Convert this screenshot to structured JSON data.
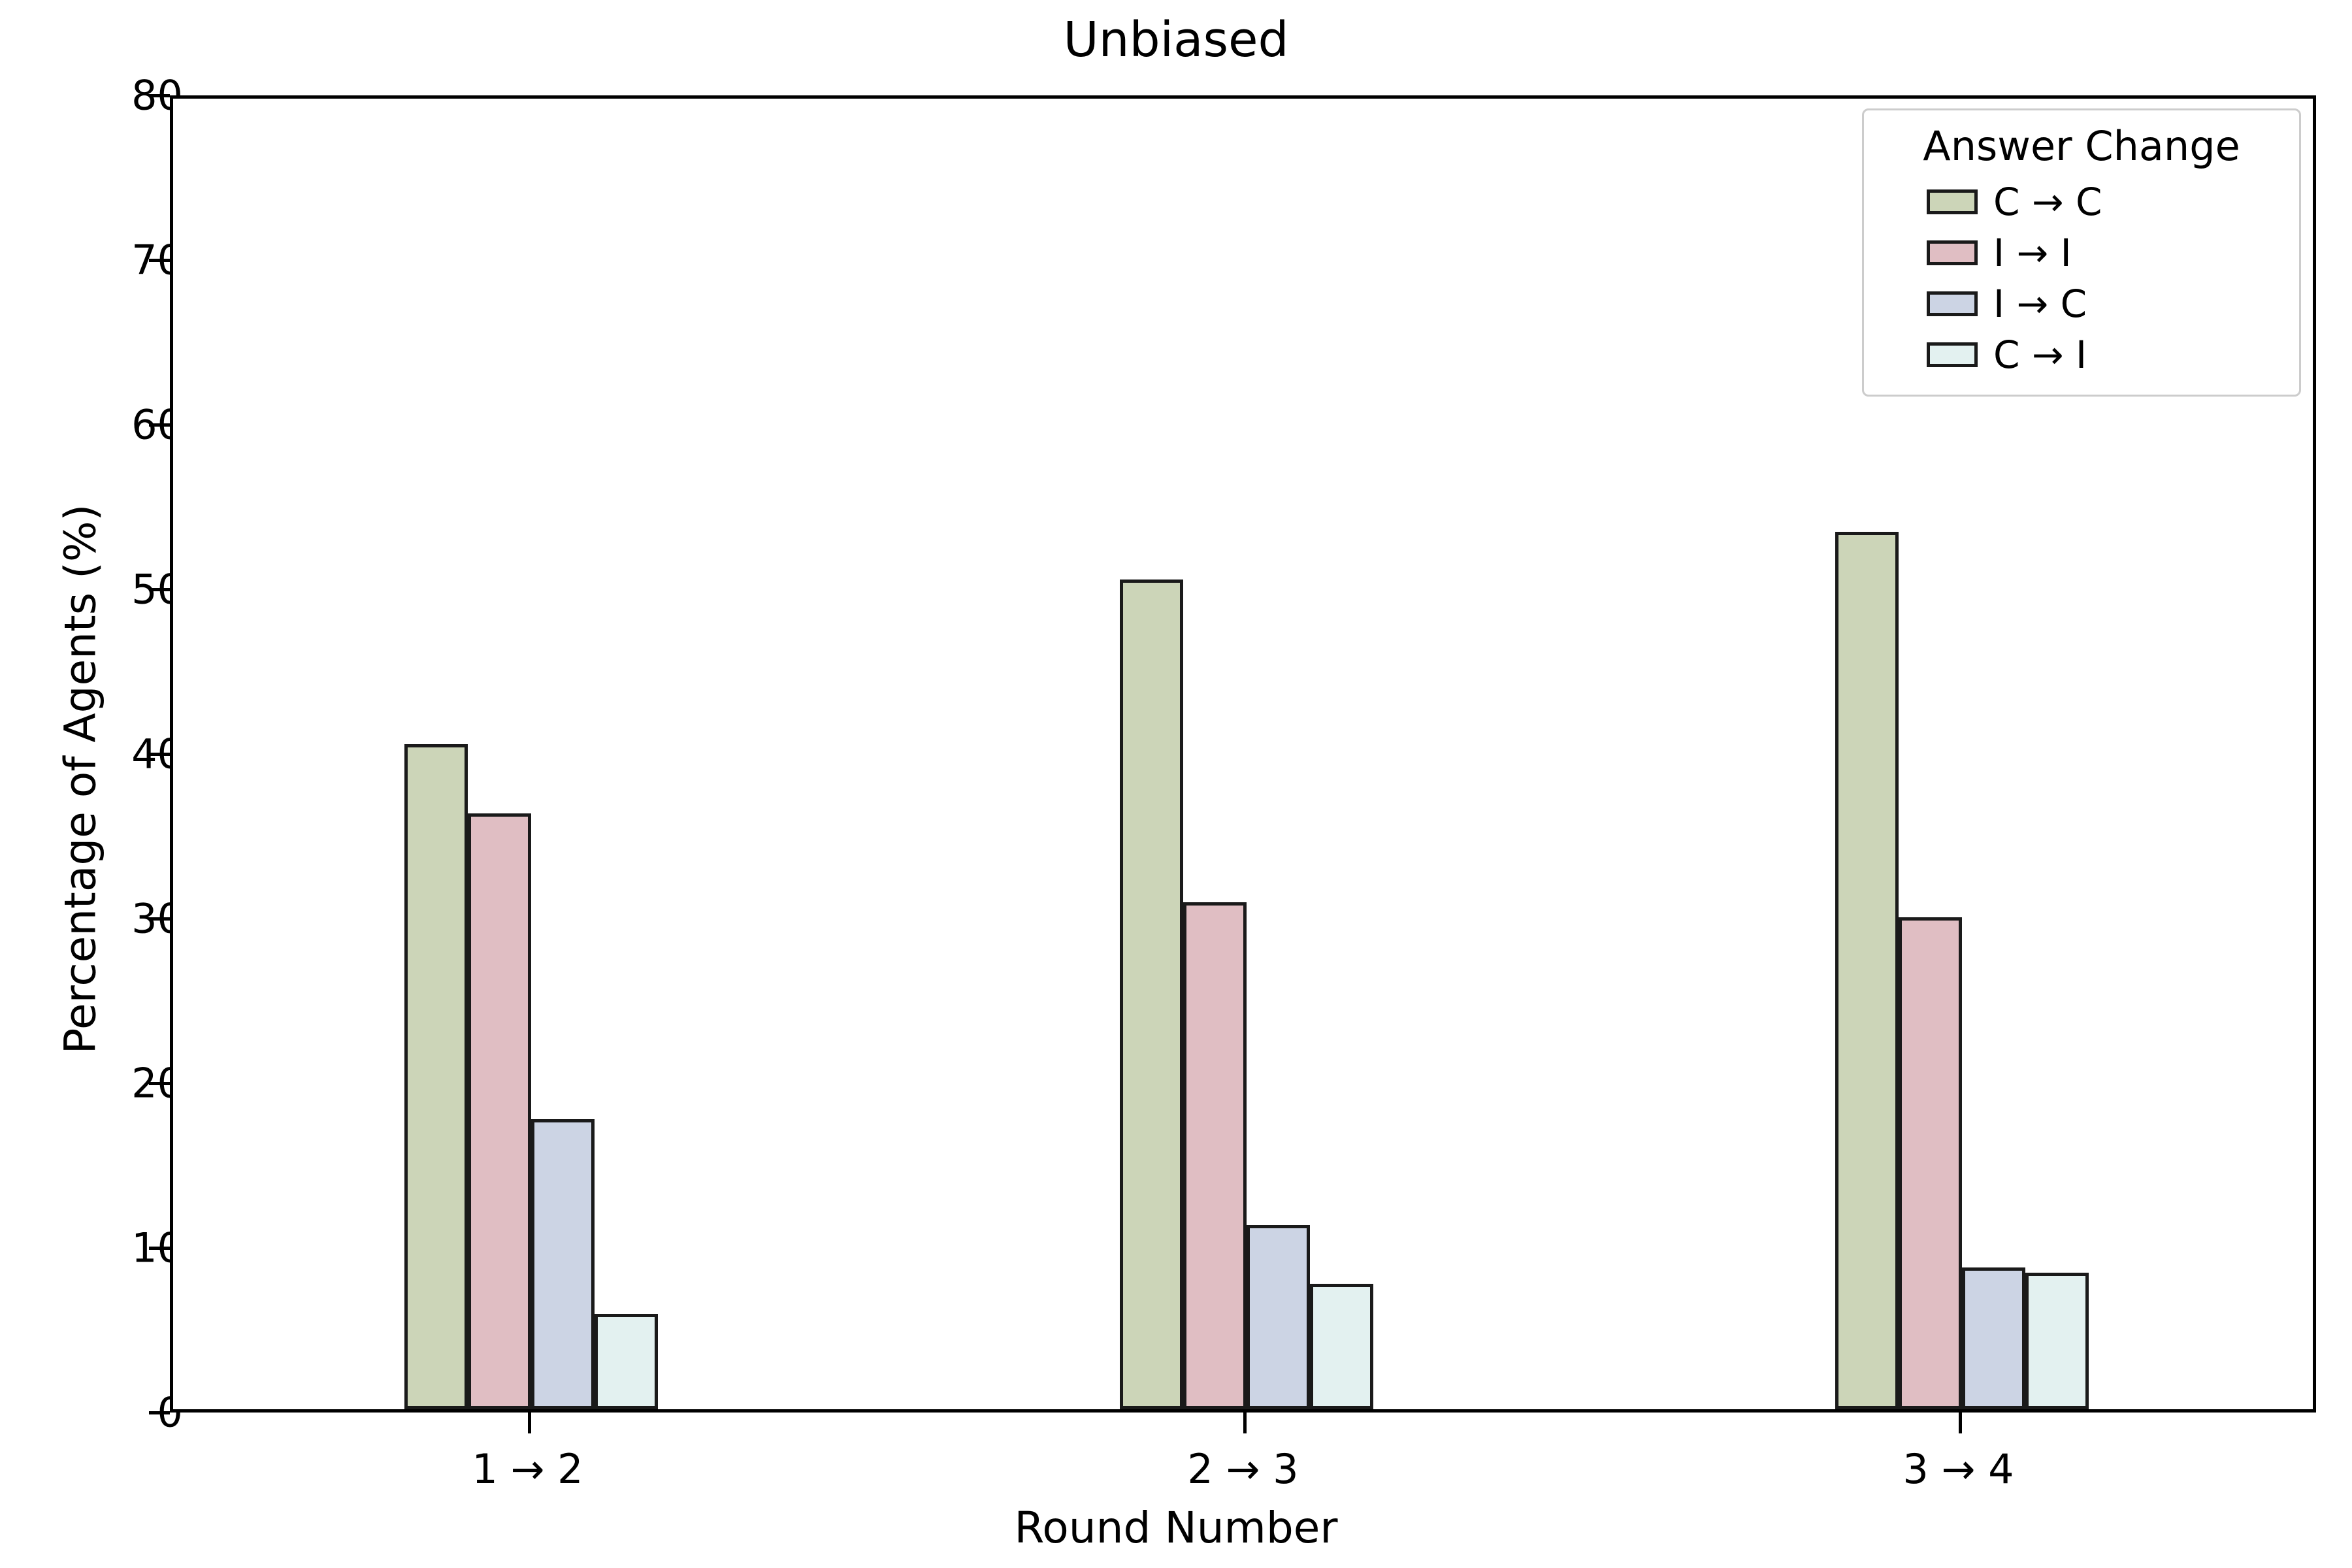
{
  "chart_data": {
    "type": "bar",
    "title": "Unbiased",
    "xlabel": "Round Number",
    "ylabel": "Percentage of Agents (%)",
    "categories": [
      "1 → 2",
      "2 → 3",
      "3 → 4"
    ],
    "ylim": [
      0,
      80
    ],
    "yticks": [
      0,
      10,
      20,
      30,
      40,
      50,
      60,
      70,
      80
    ],
    "ytick_labels": [
      "0",
      "10",
      "20",
      "30",
      "40",
      "50",
      "60",
      "70",
      "80"
    ],
    "grid": false,
    "legend_position": "upper right",
    "legend_title": "Answer Change",
    "series": [
      {
        "name": "C → C",
        "color": "#ccd5b8",
        "edge_color": "#1a1a1a",
        "values": [
          40.4,
          50.4,
          53.3
        ]
      },
      {
        "name": "I → I",
        "color": "#e0bec3",
        "edge_color": "#1a1a1a",
        "values": [
          36.2,
          30.8,
          29.9
        ]
      },
      {
        "name": "I → C",
        "color": "#ccd4e4",
        "edge_color": "#1a1a1a",
        "values": [
          17.6,
          11.2,
          8.6
        ]
      },
      {
        "name": "C → I",
        "color": "#e3f1f0",
        "edge_color": "#1a1a1a",
        "values": [
          5.8,
          7.6,
          8.3
        ]
      }
    ]
  }
}
